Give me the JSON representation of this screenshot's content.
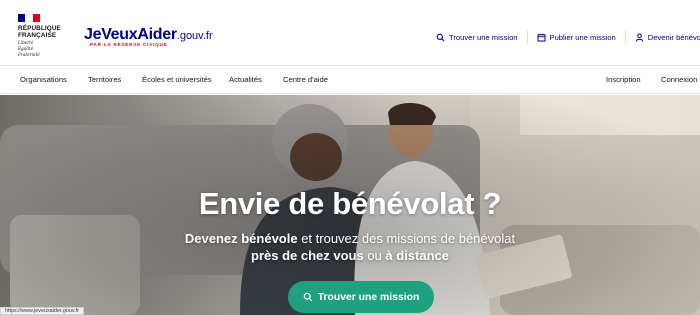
{
  "rf_logo": {
    "lines": [
      "RÉPUBLIQUE",
      "FRANÇAISE"
    ],
    "motto": [
      "Liberté",
      "Égalité",
      "Fraternité"
    ],
    "flag_colors": [
      "#000091",
      "#ffffff",
      "#e1000f"
    ]
  },
  "brand": {
    "name": "JeVeuxAider",
    "suffix": ".gouv.fr",
    "tagline": "PAR LA RÉSERVE CIVIQUE",
    "color": "#000091",
    "tagline_color": "#e1000f"
  },
  "header_links": [
    {
      "label": "Trouver une mission",
      "icon": "search-icon"
    },
    {
      "label": "Publier une mission",
      "icon": "calendar-icon"
    },
    {
      "label": "Devenir bénévole",
      "icon": "user-icon"
    }
  ],
  "nav": {
    "left": [
      "Organisations",
      "Territoires",
      "Écoles et universités",
      "Actualités",
      "Centre d'aide"
    ],
    "right": [
      "Inscription",
      "Connexion"
    ]
  },
  "hero": {
    "title": "Envie de bénévolat ?",
    "subtitle_line1_bold": "Devenez bénévole",
    "subtitle_line1_rest": " et trouvez des missions de bénévolat",
    "subtitle_line2_bold_a": "près de chez vous",
    "subtitle_line2_mid": " ou ",
    "subtitle_line2_bold_b": "à distance",
    "cta_label": "Trouver une mission",
    "cta_icon": "search-icon",
    "cta_color": "#1fa07f"
  },
  "status_bar_url": "https://www.jeveuxaider.gouv.fr"
}
